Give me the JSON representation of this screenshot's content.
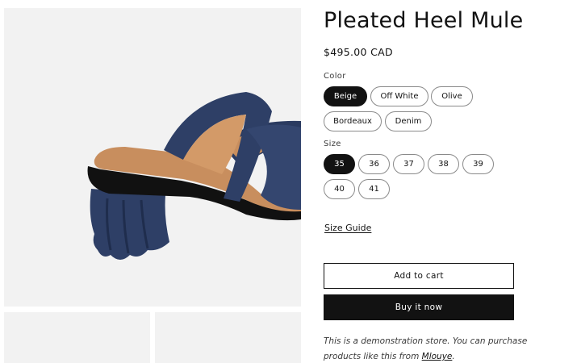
{
  "product": {
    "title": "Pleated Heel Mule",
    "price": "$495.00 CAD"
  },
  "color": {
    "label": "Color",
    "selected": "Beige",
    "options": [
      "Beige",
      "Off White",
      "Olive",
      "Bordeaux",
      "Denim"
    ]
  },
  "size": {
    "label": "Size",
    "selected": "35",
    "options": [
      "35",
      "36",
      "37",
      "38",
      "39",
      "40",
      "41"
    ]
  },
  "size_guide": "Size Guide",
  "buttons": {
    "add_to_cart": "Add to cart",
    "buy_now": "Buy it now"
  },
  "demo_note": {
    "text": "This is a demonstration store. You can purchase products like this from ",
    "link": "Mlouye",
    "suffix": "."
  },
  "colors": {
    "shoe": "#2e3f66",
    "lining": "#c88e5e",
    "sole": "#111111",
    "media_bg": "#f2f2f2",
    "button_dark": "#121212"
  }
}
